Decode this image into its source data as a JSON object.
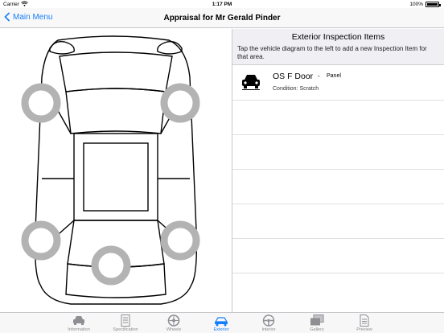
{
  "status_bar": {
    "carrier": "Carrier",
    "time": "1:17 PM",
    "battery": "100%"
  },
  "nav": {
    "back_label": "Main Menu",
    "title": "Appraisal for Mr Gerald Pinder"
  },
  "panel": {
    "title": "Exterior Inspection Items",
    "instructions": "Tap the vehicle diagram to the left to add a new Inspection Item for that area.",
    "items": [
      {
        "title": "OS F Door",
        "separator": "-",
        "type": "Panel",
        "condition": "Condition: Scratch",
        "icon": "car-front-icon"
      }
    ]
  },
  "tabs": [
    {
      "label": "Information",
      "icon": "car-icon",
      "active": false
    },
    {
      "label": "Specification",
      "icon": "list-icon",
      "active": false
    },
    {
      "label": "Wheels",
      "icon": "wheel-icon",
      "active": false
    },
    {
      "label": "Exterior",
      "icon": "exterior-icon",
      "active": true
    },
    {
      "label": "Interior",
      "icon": "steering-wheel-icon",
      "active": false
    },
    {
      "label": "Gallery",
      "icon": "gallery-icon",
      "active": false
    },
    {
      "label": "Preview",
      "icon": "document-icon",
      "active": false
    }
  ],
  "colors": {
    "accent": "#157efb",
    "tab_inactive": "#8e8e93",
    "tyre": "#b3b3b3"
  }
}
